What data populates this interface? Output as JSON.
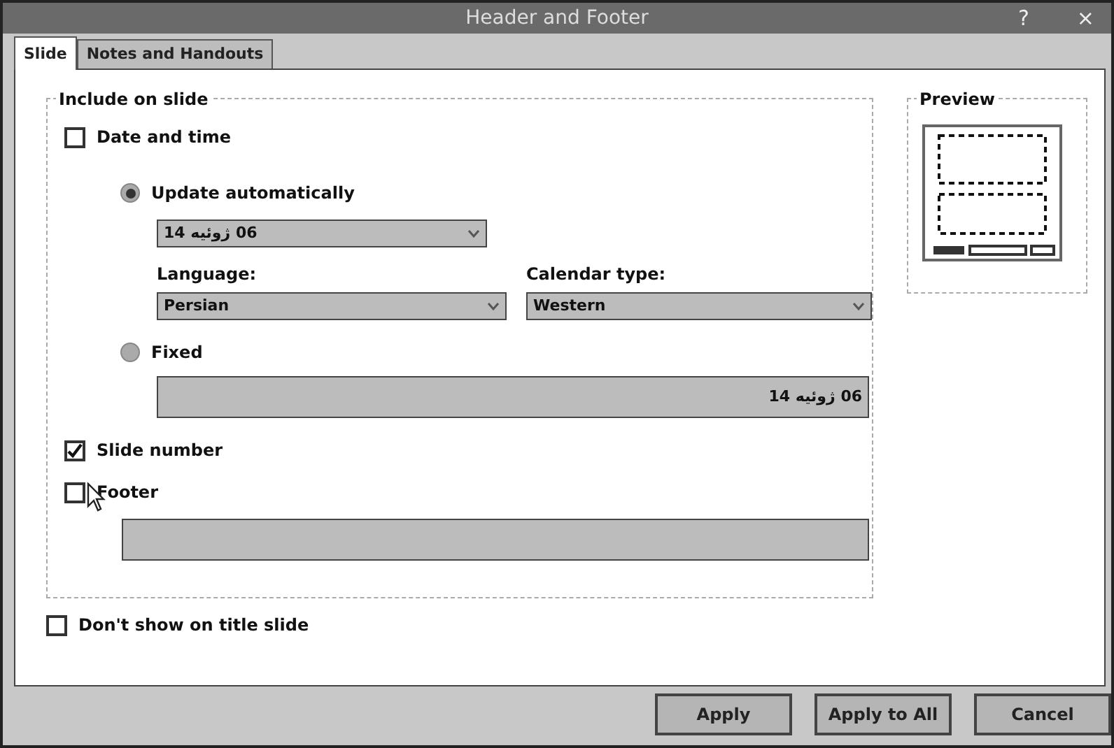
{
  "window": {
    "title": "Header and Footer",
    "help": "?",
    "close": "×"
  },
  "tabs": [
    {
      "label": "Slide",
      "selected": true
    },
    {
      "label": "Notes and Handouts",
      "selected": false
    }
  ],
  "include_group": {
    "title": "Include on slide",
    "date_time": {
      "label": "Date and time",
      "checked": false
    },
    "update_auto": {
      "label": "Update automatically",
      "selected": true
    },
    "date_dropdown": {
      "value": "06 ژوئیه 14",
      "disabled": true
    },
    "language": {
      "label": "Language:",
      "value": "Persian",
      "disabled": true
    },
    "calendar": {
      "label": "Calendar type:",
      "value": "Western",
      "disabled": true
    },
    "fixed": {
      "label": "Fixed",
      "selected": false
    },
    "fixed_field": {
      "value": "06 ژوئیه 14",
      "disabled": true
    },
    "slide_number": {
      "label": "Slide number",
      "checked": true
    },
    "footer": {
      "label": "Footer",
      "checked": false
    },
    "footer_field": {
      "disabled": true
    }
  },
  "preview": {
    "title": "Preview"
  },
  "dont_show_title": {
    "label": "Don't show on title slide",
    "checked": false
  },
  "buttons": [
    {
      "label": "Apply"
    },
    {
      "label": "Apply to All"
    },
    {
      "label": "Cancel"
    }
  ]
}
